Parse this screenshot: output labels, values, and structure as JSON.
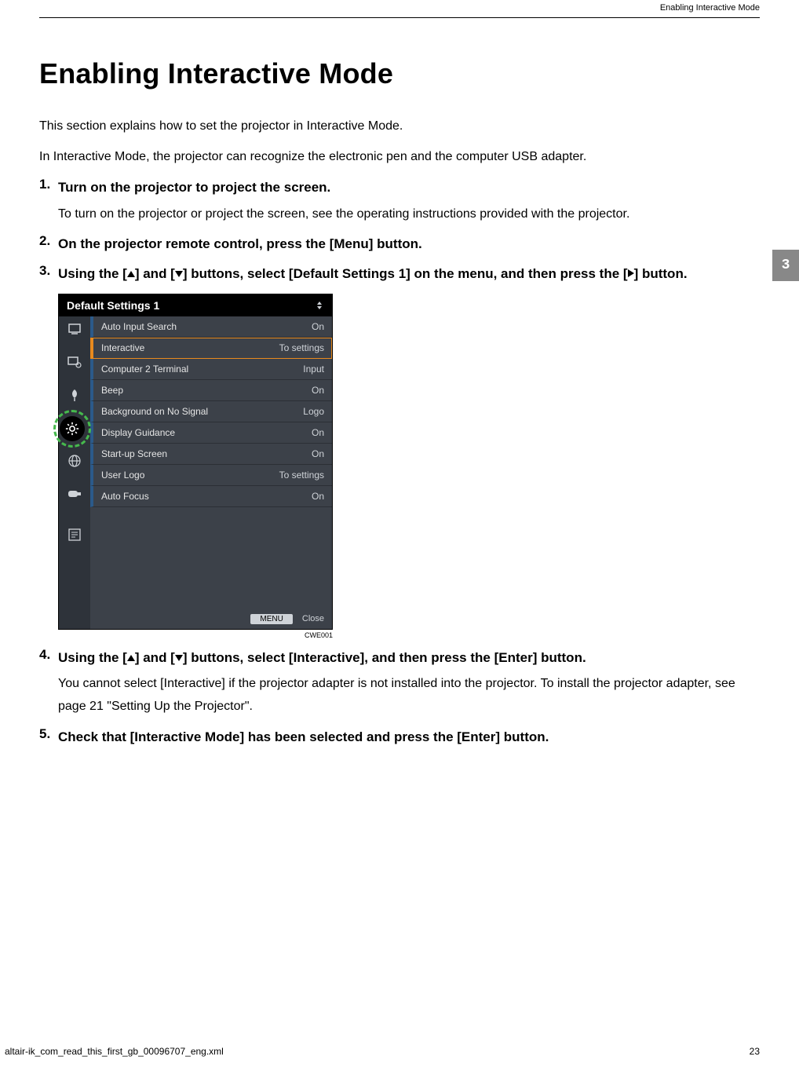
{
  "header": {
    "breadcrumb": "Enabling Interactive Mode"
  },
  "tab": {
    "number": "3"
  },
  "title": "Enabling Interactive Mode",
  "intro": {
    "p1": "This section explains how to set the projector in Interactive Mode.",
    "p2": "In Interactive Mode, the projector can recognize the electronic pen and the computer USB adapter."
  },
  "steps": {
    "s1": {
      "num": "1.",
      "head": "Turn on the projector to project the screen.",
      "body": "To turn on the projector or project the screen, see the operating instructions provided with the projector."
    },
    "s2": {
      "num": "2.",
      "head": "On the projector remote control, press the [Menu] button."
    },
    "s3": {
      "num": "3.",
      "head_a": "Using the [",
      "head_b": "] and [",
      "head_c": "] buttons, select [Default Settings 1] on the menu, and then press the [",
      "head_d": "] button."
    },
    "s4": {
      "num": "4.",
      "head_a": "Using the [",
      "head_b": "] and [",
      "head_c": "] buttons, select [Interactive], and then press the [Enter] button.",
      "body": "You cannot select [Interactive] if the projector adapter is not installed into the projector. To install the projector adapter, see page 21 \"Setting Up the Projector\"."
    },
    "s5": {
      "num": "5.",
      "head": "Check that [Interactive Mode] has been selected and press the [Enter] button."
    }
  },
  "menu": {
    "title": "Default Settings 1",
    "items": [
      {
        "label": "Auto Input Search",
        "value": "On",
        "selected": false
      },
      {
        "label": "Interactive",
        "value": "To settings",
        "selected": true
      },
      {
        "label": "Computer 2 Terminal",
        "value": "Input",
        "selected": false
      },
      {
        "label": "Beep",
        "value": "On",
        "selected": false
      },
      {
        "label": "Background on No Signal",
        "value": "Logo",
        "selected": false
      },
      {
        "label": "Display Guidance",
        "value": "On",
        "selected": false
      },
      {
        "label": "Start-up Screen",
        "value": "On",
        "selected": false
      },
      {
        "label": "User Logo",
        "value": "To settings",
        "selected": false
      },
      {
        "label": "Auto Focus",
        "value": "On",
        "selected": false
      }
    ],
    "footer": {
      "menu_btn": "MENU",
      "close": "Close"
    },
    "caption": "CWE001"
  },
  "footer": {
    "filename": "altair-ik_com_read_this_first_gb_00096707_eng.xml",
    "page": "23"
  }
}
